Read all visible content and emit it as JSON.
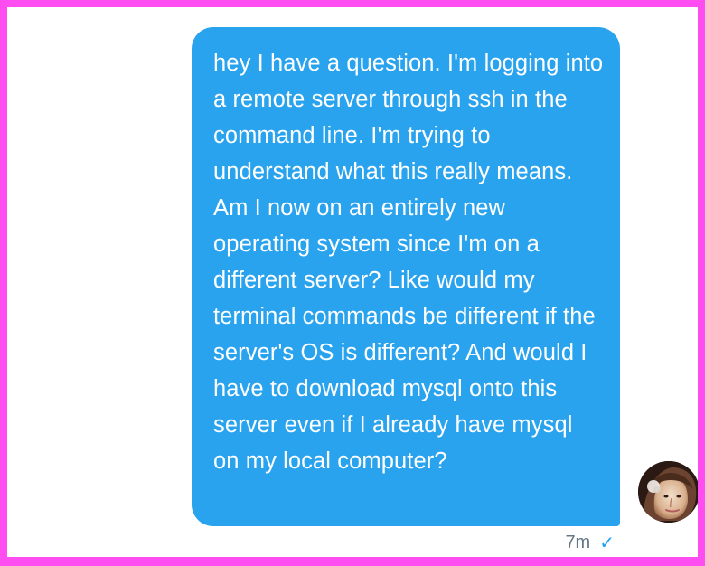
{
  "conversation": {
    "message": {
      "text": "hey I have a question. I'm logging into a remote server through ssh in the command line. I'm trying to understand what this really means. Am I now on an entirely new operating system since I'm on a different server? Like would my terminal commands be different if the server's OS is different? And would I have to download mysql onto this server even if I already have mysql on my local computer?",
      "time": "7m",
      "status_icon": "check-icon",
      "status_glyph": "✓"
    },
    "avatar": {
      "icon": "avatar-icon"
    }
  },
  "colors": {
    "frame": "#ff4df2",
    "background": "#ffffff",
    "bubble": "#2aa3ef",
    "meta_text": "#657786",
    "check": "#1da1f2"
  }
}
